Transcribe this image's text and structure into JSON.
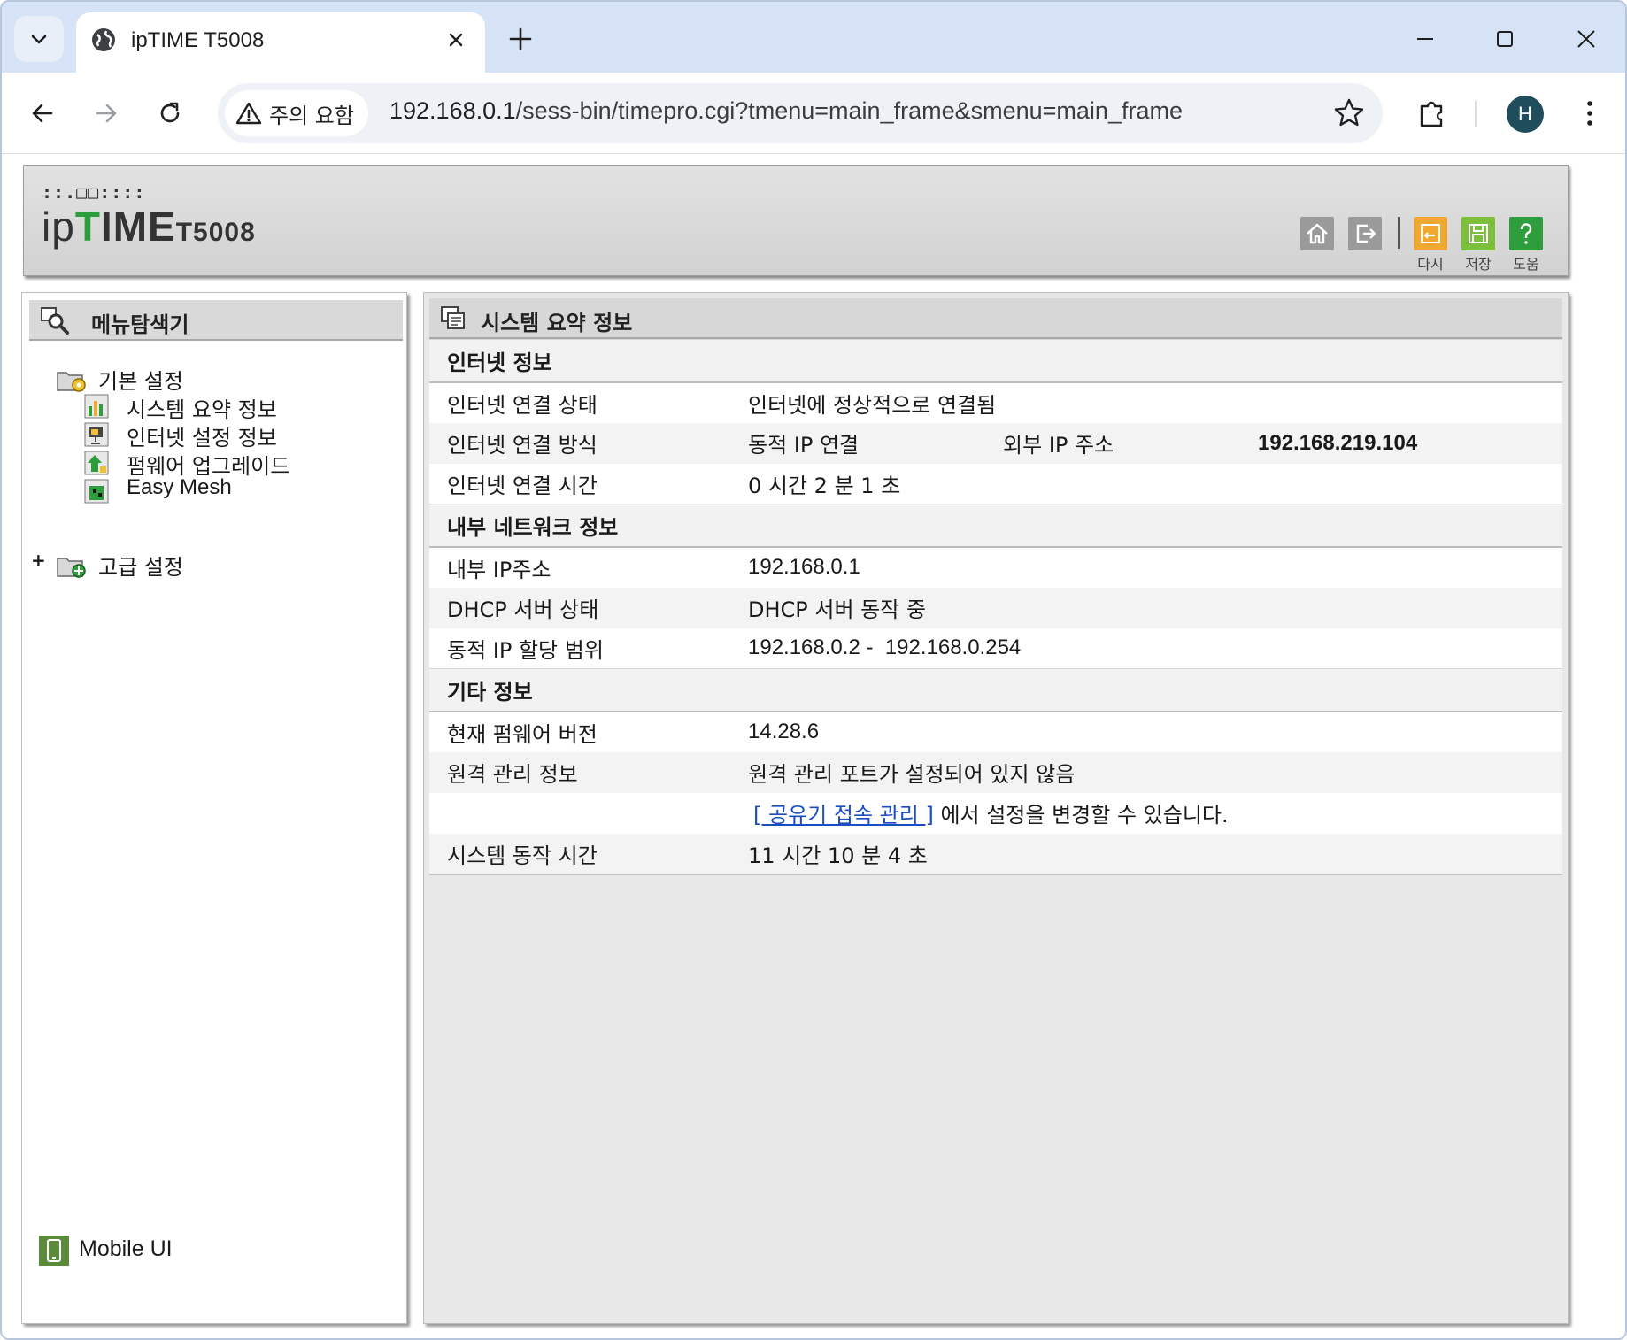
{
  "browser": {
    "tab_title": "ipTIME T5008",
    "security_label": "주의 요함",
    "url_host": "192.168.0.1",
    "url_path": "/sess-bin/timepro.cgi?tmenu=main_frame&smenu=main_frame",
    "profile_initial": "H"
  },
  "header": {
    "logo_dots": "::.□□::::",
    "logo_ip": "ip",
    "logo_t": "T",
    "logo_ime": "IME",
    "logo_model": "T5008",
    "buttons": [
      {
        "name": "home",
        "label": ""
      },
      {
        "name": "logout",
        "label": ""
      },
      {
        "name": "reload",
        "label": "다시"
      },
      {
        "name": "save",
        "label": "저장"
      },
      {
        "name": "help",
        "label": "도움"
      }
    ],
    "colors": {
      "reload": "#f0a830",
      "save": "#7cbf3a",
      "help": "#2e9e3c"
    }
  },
  "menu": {
    "title": "메뉴탐색기",
    "basic_group": "기본 설정",
    "items": [
      "시스템 요약 정보",
      "인터넷 설정 정보",
      "펌웨어 업그레이드",
      "Easy Mesh"
    ],
    "advanced_group": "고급 설정",
    "expand_symbol": "+",
    "mobile_ui": "Mobile UI"
  },
  "main": {
    "title": "시스템 요약 정보",
    "internet": {
      "section": "인터넷 정보",
      "status_label": "인터넷 연결 상태",
      "status_value": "인터넷에 정상적으로 연결됨",
      "method_label": "인터넷 연결 방식",
      "method_value": "동적 IP 연결",
      "ext_ip_label": "외부 IP 주소",
      "ext_ip_value": "192.168.219.104",
      "time_label": "인터넷 연결 시간",
      "time_value": "0 시간 2 분 1 초"
    },
    "lan": {
      "section": "내부 네트워크 정보",
      "ip_label": "내부 IP주소",
      "ip_value": "192.168.0.1",
      "dhcp_label": "DHCP 서버 상태",
      "dhcp_value": "DHCP 서버 동작 중",
      "range_label": "동적 IP 할당 범위",
      "range_value": "192.168.0.2 -  192.168.0.254"
    },
    "etc": {
      "section": "기타 정보",
      "fw_label": "현재 펌웨어 버전",
      "fw_value": "14.28.6",
      "remote_label": "원격 관리 정보",
      "remote_value": "원격 관리 포트가 설정되어 있지 않음",
      "remote_link": "[ 공유기 접속 관리 ]",
      "remote_note": " 에서 설정을 변경할 수 있습니다.",
      "uptime_label": "시스템 동작 시간",
      "uptime_value": "11 시간 10 분 4 초"
    }
  }
}
